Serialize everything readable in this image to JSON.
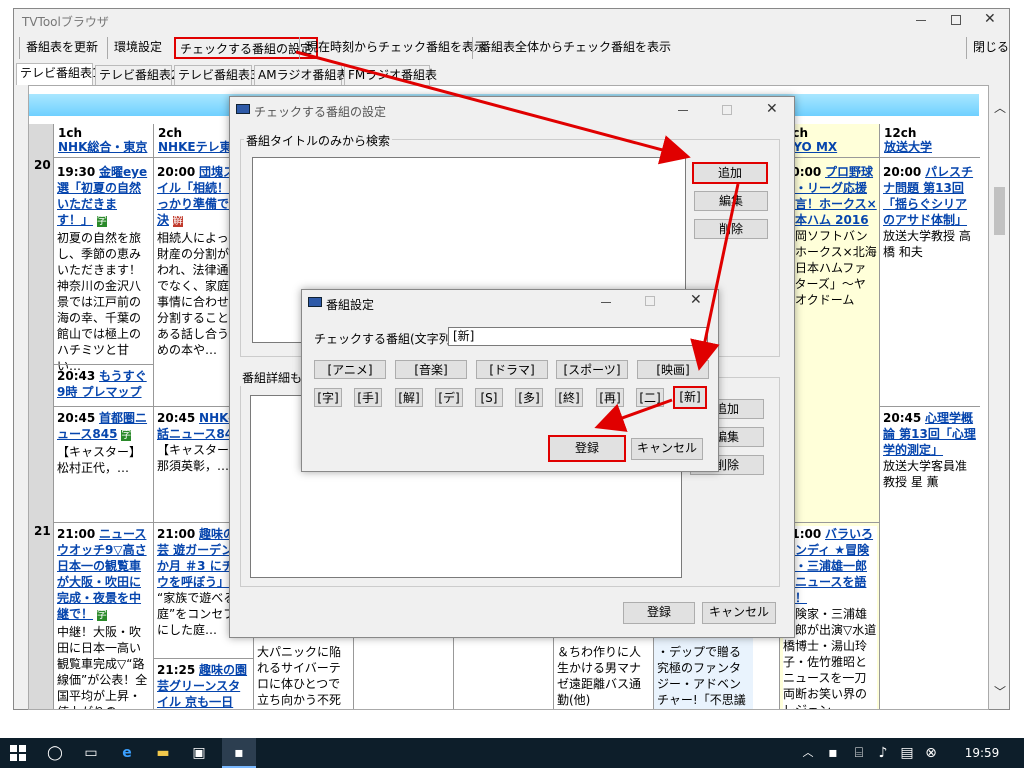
{
  "app": {
    "title": "TVToolブラウザ"
  },
  "toolbar": {
    "refresh": "番組表を更新",
    "env": "環境設定",
    "check_settings": "チェックする番組の設定",
    "from_now": "現在時刻からチェック番組を表示",
    "all": "番組表全体からチェック番組を表示",
    "close": "閉じる"
  },
  "tabs": [
    "テレビ番組表1",
    "テレビ番組表2",
    "テレビ番組表3",
    "AMラジオ番組表",
    "FMラジオ番組表"
  ],
  "channels": {
    "c1": {
      "num": "1ch",
      "name": "NHK総合・東京"
    },
    "c2": {
      "num": "2ch",
      "name": "NHKEテレ東京"
    },
    "c9": {
      "num": "9ch",
      "name": "KYO MX"
    },
    "c12": {
      "num": "12ch",
      "name": "放送大学"
    }
  },
  "hours": [
    "20",
    "21"
  ],
  "programs": {
    "p1a": {
      "time": "19:30",
      "title": "金曜eye選「初夏の自然いただきます！」",
      "tag": "字",
      "desc": "初夏の自然を旅し、季節の恵みいただきます！神奈川の金沢八景では江戸前の海の幸、千葉の館山では極上のハチミツと甘い…"
    },
    "p1b": {
      "time": "20:43",
      "title": "もうすぐ9時 プレマップ"
    },
    "p1c": {
      "time": "20:45",
      "title": "首都圏ニュース845",
      "tag": "字",
      "desc": "【キャスター】松村正代，…"
    },
    "p1d": {
      "time": "21:00",
      "title": "ニュースウオッチ9▽高さ日本一の観覧車が大阪・吹田に完成・夜景を中継で！",
      "tag": "字",
      "desc": "中継！大阪・吹田に日本一高い観覧車完成▽“路線価”が公表！全国平均が上昇・値上がりの"
    },
    "p2a": {
      "time": "20:00",
      "title": "団塊スタイル「相続！しっかり準備で解決",
      "tag": "解",
      "desc": "相続人によって財産の分割が行われ、法律通りでなく、家庭の事情に合わせて分割することがある話し合うための本や…"
    },
    "p2b": {
      "time": "20:45",
      "title": "NHK手話ニュース845",
      "desc": "【キャスター】那須英彰，…"
    },
    "p2c": {
      "time": "21:00",
      "title": "趣味の園芸 遊ガーデン12か月 ＃3 にチョウを呼ぼう」",
      "desc": "“家族で遊べる庭”をコンセプトにした庭…"
    },
    "p2d": {
      "time": "21:25",
      "title": "趣味の園芸グリーンスタイル 京も一日"
    },
    "p9a": {
      "time": "20:00",
      "title": "プロ野球パ・リーグ応援宣言！ホークス×日本ハム 2016",
      "desc": "福岡ソフトバンクホークス×北海道日本ハムファイターズ」～ヤフオクドーム"
    },
    "p9b": {
      "time": "21:00",
      "title": "バラいろダンディ ★冒険家・三浦雄一郎がニュースを語る！",
      "desc": "冒険家・三浦雄一郎が出演▽水道橋博士・湯山玲子・佐竹雅昭とニュースを一刀両断お笑い界のレジェン…"
    },
    "p12a": {
      "time": "20:00",
      "title": "パレスチナ問題 第13回「揺らぐシリアのアサド体制」",
      "desc": "放送大学教授 高橋 和夫"
    },
    "p12b": {
      "time": "20:45",
      "title": "心理学概論 第13回「心理学的測定」",
      "desc": "放送大学客員准教授 星 薫"
    },
    "px1": {
      "desc": "大パニックに陥れるサイバーテロに体ひとつで立ち向かう不死身の男!"
    },
    "px2": {
      "desc": "＆ちわ作りに人生かける男マナゼ遠距離バス通勤(他)"
    },
    "px3": {
      "desc": "・デップで贈る究極のファンタジー・アドベンチャー!「不思議"
    }
  },
  "dialog_check": {
    "title": "チェックする番組の設定",
    "group1": "番組タイトルのみから検索",
    "group2": "番組詳細も含めて検索",
    "add": "追加",
    "edit": "編集",
    "delete": "削除",
    "ok": "登録",
    "cancel": "キャンセル"
  },
  "dialog_prog": {
    "title": "番組設定",
    "label": "チェックする番組(文字列)",
    "value": "[新]",
    "genres": [
      "[アニメ]",
      "[音楽]",
      "[ドラマ]",
      "[スポーツ]",
      "[映画]"
    ],
    "marks": [
      "[字]",
      "[手]",
      "[解]",
      "[デ]",
      "[S]",
      "[多]",
      "[終]",
      "[再]",
      "[二]",
      "[新]"
    ],
    "ok": "登録",
    "cancel": "キャンセル"
  },
  "taskbar": {
    "time": "19:59"
  },
  "colors": {
    "highlight": "#e00000",
    "link": "#0645ad",
    "accent_bar": "#6fd0ff"
  }
}
